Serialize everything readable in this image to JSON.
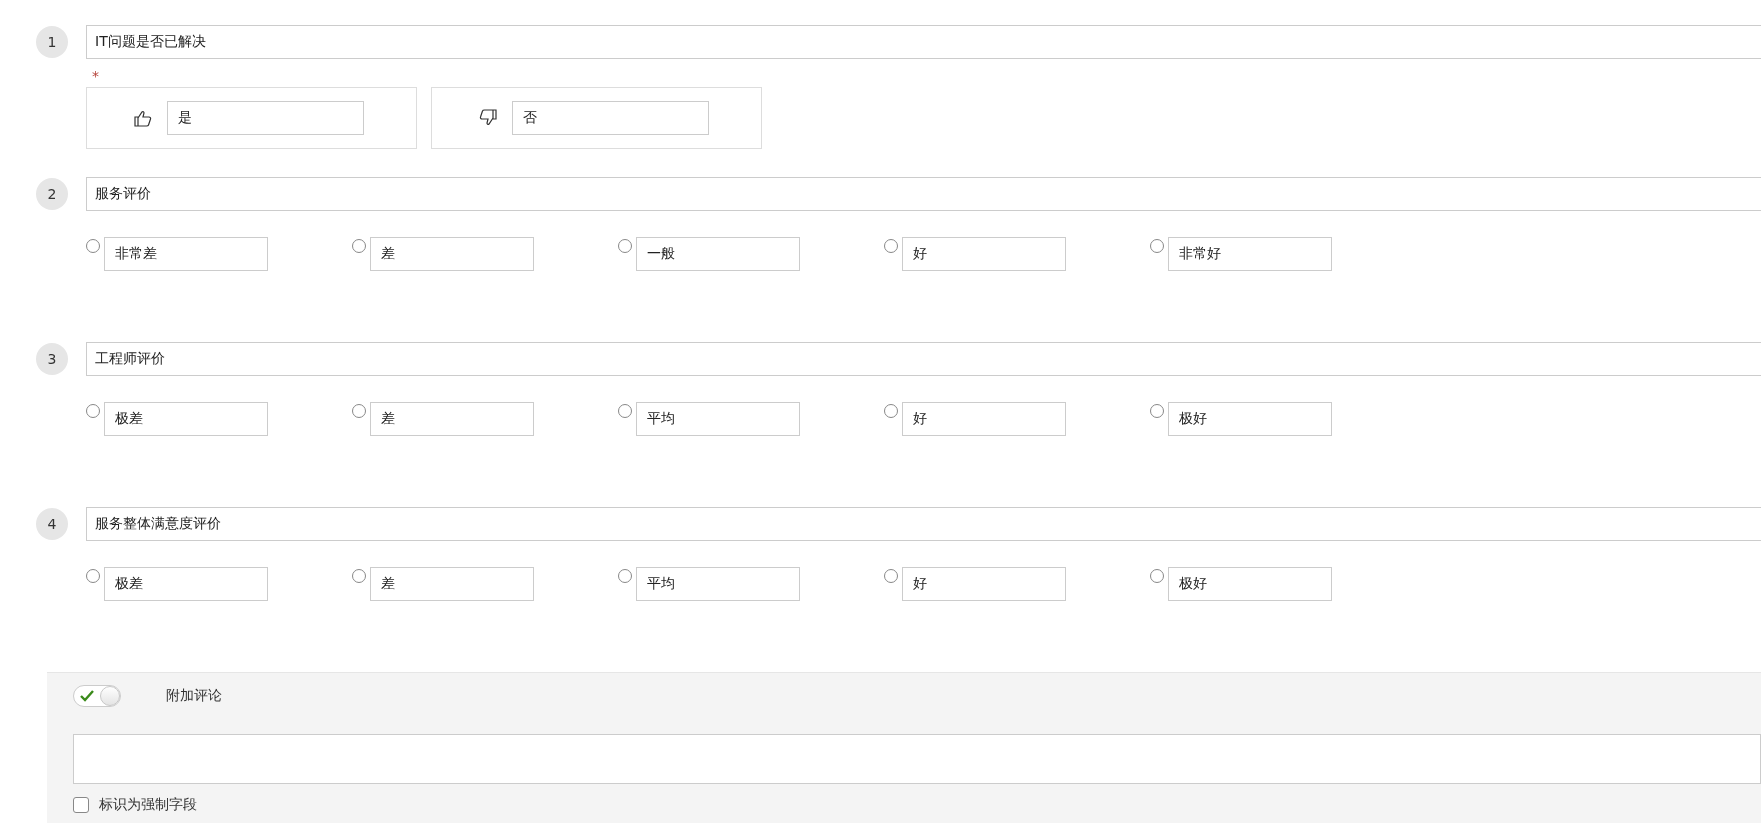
{
  "questions": [
    {
      "number": "1",
      "title": "IT问题是否已解决",
      "required_mark": "*",
      "kind": "thumbs",
      "options": [
        {
          "label": "是",
          "selected": false
        },
        {
          "label": "否",
          "selected": false
        }
      ]
    },
    {
      "number": "2",
      "title": "服务评价",
      "kind": "radio",
      "options": [
        {
          "label": "非常差",
          "selected": false
        },
        {
          "label": "差",
          "selected": false
        },
        {
          "label": "一般",
          "selected": false
        },
        {
          "label": "好",
          "selected": false
        },
        {
          "label": "非常好",
          "selected": false
        }
      ]
    },
    {
      "number": "3",
      "title": "工程师评价",
      "kind": "radio",
      "options": [
        {
          "label": "极差",
          "selected": false
        },
        {
          "label": "差",
          "selected": false
        },
        {
          "label": "平均",
          "selected": false
        },
        {
          "label": "好",
          "selected": false
        },
        {
          "label": "极好",
          "selected": false
        }
      ]
    },
    {
      "number": "4",
      "title": "服务整体满意度评价",
      "kind": "radio",
      "options": [
        {
          "label": "极差",
          "selected": false
        },
        {
          "label": "差",
          "selected": false
        },
        {
          "label": "平均",
          "selected": false
        },
        {
          "label": "好",
          "selected": false
        },
        {
          "label": "极好",
          "selected": false
        }
      ]
    }
  ],
  "comments": {
    "label": "附加评论",
    "on": true,
    "mandatory": {
      "label": "标识为强制字段",
      "checked": false
    }
  }
}
